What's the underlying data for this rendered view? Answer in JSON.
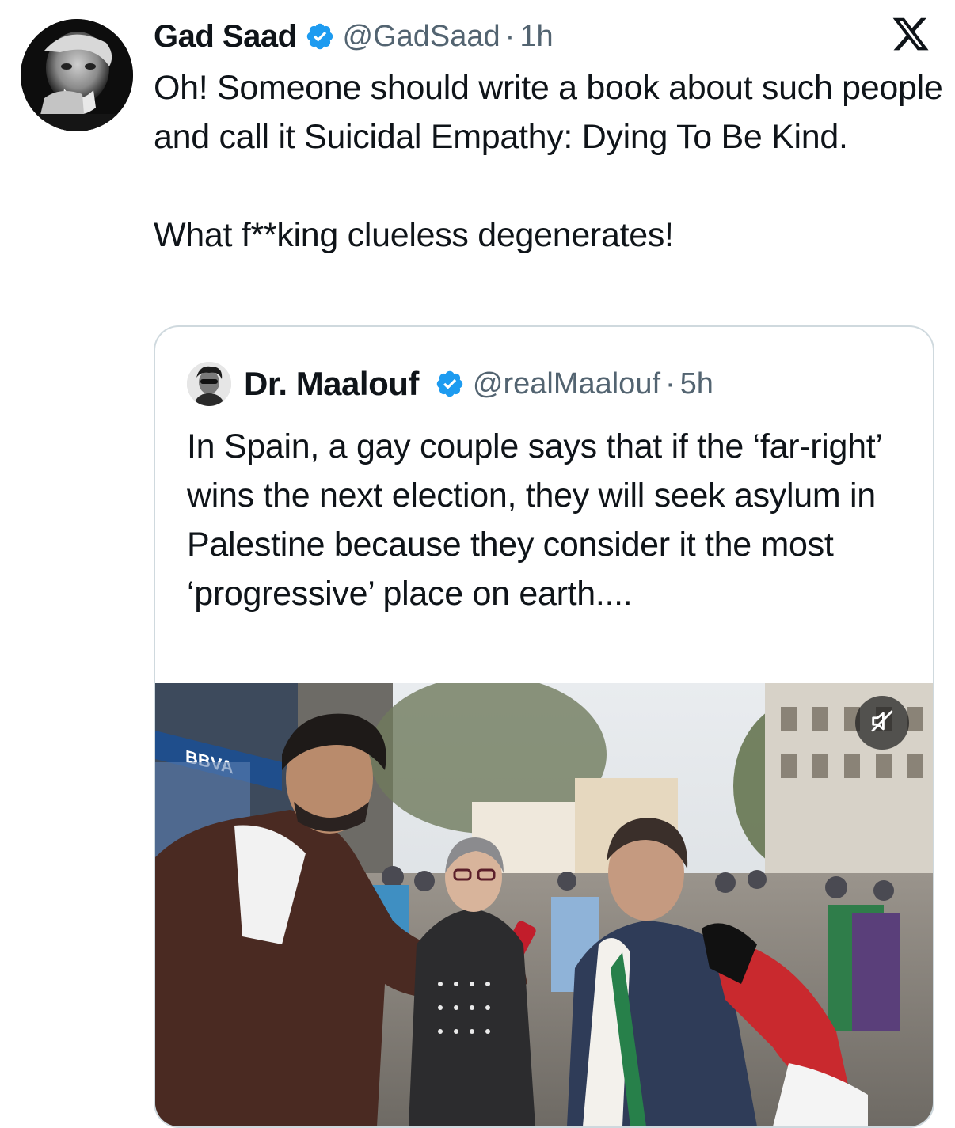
{
  "tweet": {
    "author_name": "Gad Saad",
    "author_handle": "@GadSaad",
    "separator": "·",
    "time": "1h",
    "text_line_1": "Oh!  Someone should write a book about such people and call it Suicidal Empathy: Dying To Be Kind.",
    "text_line_2": "What f**king clueless degenerates!",
    "verified": true
  },
  "quoted_tweet": {
    "author_name": "Dr. Maalouf",
    "author_handle": "@realMaalouf",
    "separator": "·",
    "time": "5h",
    "text": "In Spain, a gay couple says that if the ‘far-right’ wins the next election, they will seek asylum in Palestine because they consider it the most ‘progressive’ place on earth....",
    "verified": true,
    "media": {
      "type": "video",
      "sign_text": "BBVA",
      "muted": true
    }
  },
  "icons": {
    "platform_logo": "x-logo-icon",
    "verified_badge": "verified-badge-icon",
    "mute": "speaker-muted-icon"
  },
  "colors": {
    "verified_blue": "#1d9bf0",
    "secondary_text": "#536471",
    "border": "#cfd9de"
  }
}
